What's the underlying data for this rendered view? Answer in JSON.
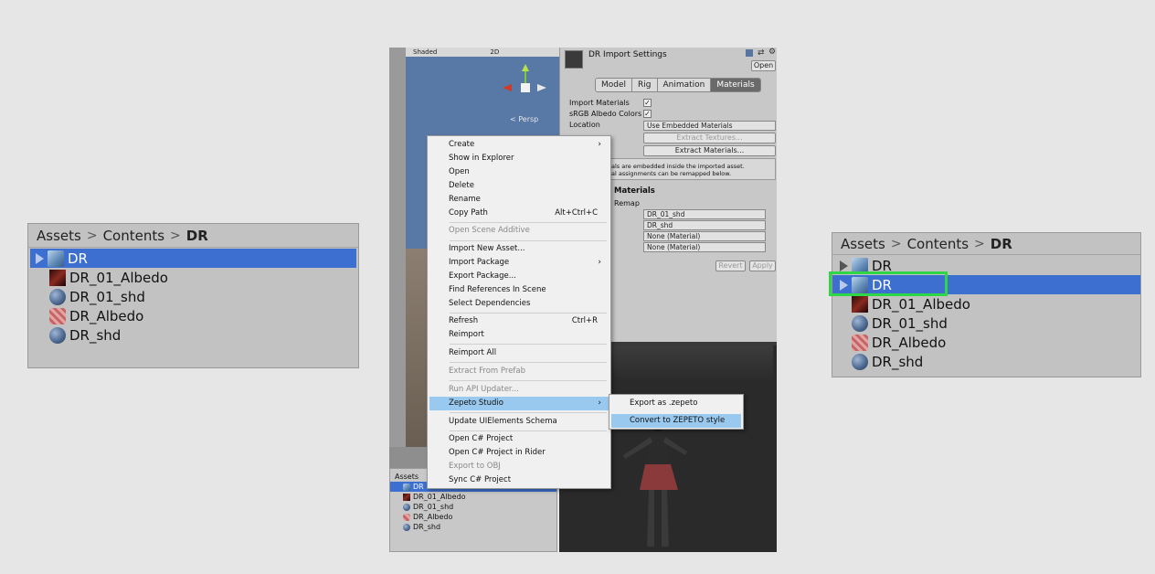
{
  "left_panel": {
    "breadcrumb": [
      "Assets",
      "Contents",
      "DR"
    ],
    "items": [
      {
        "label": "DR",
        "icon": "prefab-cube-icon",
        "selected": true,
        "expandable": true
      },
      {
        "label": "DR_01_Albedo",
        "icon": "texture-icon"
      },
      {
        "label": "DR_01_shd",
        "icon": "material-sphere-icon"
      },
      {
        "label": "DR_Albedo",
        "icon": "albedo-texture-icon"
      },
      {
        "label": "DR_shd",
        "icon": "material-sphere-icon"
      }
    ]
  },
  "right_panel": {
    "breadcrumb": [
      "Assets",
      "Contents",
      "DR"
    ],
    "items": [
      {
        "label": "DR",
        "icon": "prefab-cube-icon",
        "expandable": true
      },
      {
        "label": "DR",
        "icon": "prefab-cube-icon",
        "selected": true,
        "expandable": true,
        "highlighted": true
      },
      {
        "label": "DR_01_Albedo",
        "icon": "texture-icon"
      },
      {
        "label": "DR_01_shd",
        "icon": "material-sphere-icon"
      },
      {
        "label": "DR_Albedo",
        "icon": "albedo-texture-icon"
      },
      {
        "label": "DR_shd",
        "icon": "material-sphere-icon"
      }
    ]
  },
  "scene": {
    "shading": "Shaded",
    "mode_2d": "2D",
    "persp": "< Persp"
  },
  "inspector": {
    "title": "DR Import Settings",
    "open_button": "Open",
    "tabs": [
      "Model",
      "Rig",
      "Animation",
      "Materials"
    ],
    "active_tab": "Materials",
    "import_materials": "Import Materials",
    "srgb": "sRGB Albedo Colors",
    "location_label": "Location",
    "location_value": "Use Embedded Materials",
    "extract_textures": "Extract Textures...",
    "extract_materials": "Extract Materials...",
    "info_line1": "als are embedded inside the imported asset.",
    "info_line2": "al assignments can be remapped below.",
    "section": "Materials",
    "remap": "Remap",
    "remap_fields": [
      "DR_01_shd",
      "DR_shd",
      "None (Material)",
      "None (Material)"
    ],
    "revert": "Revert",
    "apply": "Apply"
  },
  "project_mini": {
    "tab": "Assets",
    "items": [
      "DR",
      "DR_01_Albedo",
      "DR_01_shd",
      "DR_Albedo",
      "DR_shd"
    ]
  },
  "context_menu": {
    "items": [
      {
        "label": "Create",
        "submenu": true
      },
      {
        "label": "Show in Explorer"
      },
      {
        "label": "Open"
      },
      {
        "label": "Delete"
      },
      {
        "label": "Rename"
      },
      {
        "label": "Copy Path",
        "shortcut": "Alt+Ctrl+C"
      },
      {
        "label": "Open Scene Additive",
        "disabled": true
      },
      {
        "label": "Import New Asset..."
      },
      {
        "label": "Import Package",
        "submenu": true
      },
      {
        "label": "Export Package..."
      },
      {
        "label": "Find References In Scene"
      },
      {
        "label": "Select Dependencies"
      },
      {
        "label": "Refresh",
        "shortcut": "Ctrl+R"
      },
      {
        "label": "Reimport"
      },
      {
        "label": "Reimport All"
      },
      {
        "label": "Extract From Prefab",
        "disabled": true
      },
      {
        "label": "Run API Updater...",
        "disabled": true
      },
      {
        "label": "Zepeto Studio",
        "submenu": true,
        "highlighted": true
      },
      {
        "label": "Update UIElements Schema"
      },
      {
        "label": "Open C# Project"
      },
      {
        "label": "Open C# Project in Rider"
      },
      {
        "label": "Export to OBJ",
        "disabled": true
      },
      {
        "label": "Sync C# Project"
      }
    ],
    "submenu_items": [
      {
        "label": "Export as .zepeto"
      },
      {
        "label": "Convert to ZEPETO style",
        "highlighted": true
      }
    ]
  },
  "colors": {
    "selection": "#3d6fd0",
    "menu_highlight": "#99c9ef",
    "callout_border": "#2fd645"
  }
}
